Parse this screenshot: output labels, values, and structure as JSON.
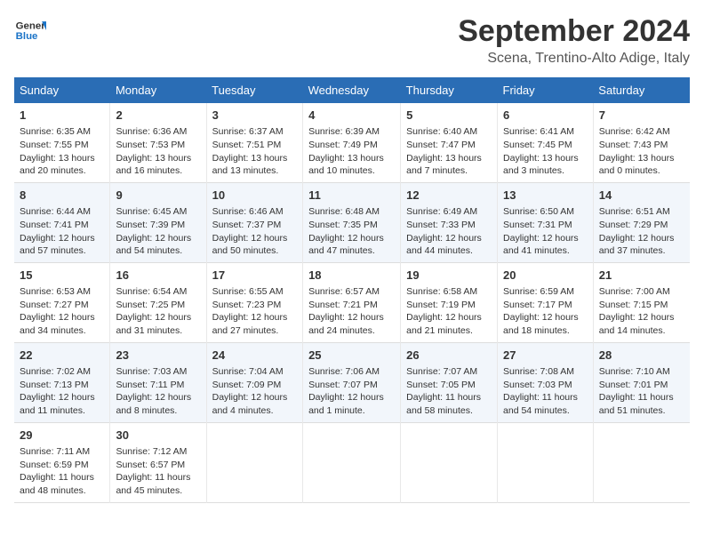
{
  "header": {
    "logo_general": "General",
    "logo_blue": "Blue",
    "month": "September 2024",
    "location": "Scena, Trentino-Alto Adige, Italy"
  },
  "days_of_week": [
    "Sunday",
    "Monday",
    "Tuesday",
    "Wednesday",
    "Thursday",
    "Friday",
    "Saturday"
  ],
  "weeks": [
    [
      {
        "day": "1",
        "lines": [
          "Sunrise: 6:35 AM",
          "Sunset: 7:55 PM",
          "Daylight: 13 hours",
          "and 20 minutes."
        ]
      },
      {
        "day": "2",
        "lines": [
          "Sunrise: 6:36 AM",
          "Sunset: 7:53 PM",
          "Daylight: 13 hours",
          "and 16 minutes."
        ]
      },
      {
        "day": "3",
        "lines": [
          "Sunrise: 6:37 AM",
          "Sunset: 7:51 PM",
          "Daylight: 13 hours",
          "and 13 minutes."
        ]
      },
      {
        "day": "4",
        "lines": [
          "Sunrise: 6:39 AM",
          "Sunset: 7:49 PM",
          "Daylight: 13 hours",
          "and 10 minutes."
        ]
      },
      {
        "day": "5",
        "lines": [
          "Sunrise: 6:40 AM",
          "Sunset: 7:47 PM",
          "Daylight: 13 hours",
          "and 7 minutes."
        ]
      },
      {
        "day": "6",
        "lines": [
          "Sunrise: 6:41 AM",
          "Sunset: 7:45 PM",
          "Daylight: 13 hours",
          "and 3 minutes."
        ]
      },
      {
        "day": "7",
        "lines": [
          "Sunrise: 6:42 AM",
          "Sunset: 7:43 PM",
          "Daylight: 13 hours",
          "and 0 minutes."
        ]
      }
    ],
    [
      {
        "day": "8",
        "lines": [
          "Sunrise: 6:44 AM",
          "Sunset: 7:41 PM",
          "Daylight: 12 hours",
          "and 57 minutes."
        ]
      },
      {
        "day": "9",
        "lines": [
          "Sunrise: 6:45 AM",
          "Sunset: 7:39 PM",
          "Daylight: 12 hours",
          "and 54 minutes."
        ]
      },
      {
        "day": "10",
        "lines": [
          "Sunrise: 6:46 AM",
          "Sunset: 7:37 PM",
          "Daylight: 12 hours",
          "and 50 minutes."
        ]
      },
      {
        "day": "11",
        "lines": [
          "Sunrise: 6:48 AM",
          "Sunset: 7:35 PM",
          "Daylight: 12 hours",
          "and 47 minutes."
        ]
      },
      {
        "day": "12",
        "lines": [
          "Sunrise: 6:49 AM",
          "Sunset: 7:33 PM",
          "Daylight: 12 hours",
          "and 44 minutes."
        ]
      },
      {
        "day": "13",
        "lines": [
          "Sunrise: 6:50 AM",
          "Sunset: 7:31 PM",
          "Daylight: 12 hours",
          "and 41 minutes."
        ]
      },
      {
        "day": "14",
        "lines": [
          "Sunrise: 6:51 AM",
          "Sunset: 7:29 PM",
          "Daylight: 12 hours",
          "and 37 minutes."
        ]
      }
    ],
    [
      {
        "day": "15",
        "lines": [
          "Sunrise: 6:53 AM",
          "Sunset: 7:27 PM",
          "Daylight: 12 hours",
          "and 34 minutes."
        ]
      },
      {
        "day": "16",
        "lines": [
          "Sunrise: 6:54 AM",
          "Sunset: 7:25 PM",
          "Daylight: 12 hours",
          "and 31 minutes."
        ]
      },
      {
        "day": "17",
        "lines": [
          "Sunrise: 6:55 AM",
          "Sunset: 7:23 PM",
          "Daylight: 12 hours",
          "and 27 minutes."
        ]
      },
      {
        "day": "18",
        "lines": [
          "Sunrise: 6:57 AM",
          "Sunset: 7:21 PM",
          "Daylight: 12 hours",
          "and 24 minutes."
        ]
      },
      {
        "day": "19",
        "lines": [
          "Sunrise: 6:58 AM",
          "Sunset: 7:19 PM",
          "Daylight: 12 hours",
          "and 21 minutes."
        ]
      },
      {
        "day": "20",
        "lines": [
          "Sunrise: 6:59 AM",
          "Sunset: 7:17 PM",
          "Daylight: 12 hours",
          "and 18 minutes."
        ]
      },
      {
        "day": "21",
        "lines": [
          "Sunrise: 7:00 AM",
          "Sunset: 7:15 PM",
          "Daylight: 12 hours",
          "and 14 minutes."
        ]
      }
    ],
    [
      {
        "day": "22",
        "lines": [
          "Sunrise: 7:02 AM",
          "Sunset: 7:13 PM",
          "Daylight: 12 hours",
          "and 11 minutes."
        ]
      },
      {
        "day": "23",
        "lines": [
          "Sunrise: 7:03 AM",
          "Sunset: 7:11 PM",
          "Daylight: 12 hours",
          "and 8 minutes."
        ]
      },
      {
        "day": "24",
        "lines": [
          "Sunrise: 7:04 AM",
          "Sunset: 7:09 PM",
          "Daylight: 12 hours",
          "and 4 minutes."
        ]
      },
      {
        "day": "25",
        "lines": [
          "Sunrise: 7:06 AM",
          "Sunset: 7:07 PM",
          "Daylight: 12 hours",
          "and 1 minute."
        ]
      },
      {
        "day": "26",
        "lines": [
          "Sunrise: 7:07 AM",
          "Sunset: 7:05 PM",
          "Daylight: 11 hours",
          "and 58 minutes."
        ]
      },
      {
        "day": "27",
        "lines": [
          "Sunrise: 7:08 AM",
          "Sunset: 7:03 PM",
          "Daylight: 11 hours",
          "and 54 minutes."
        ]
      },
      {
        "day": "28",
        "lines": [
          "Sunrise: 7:10 AM",
          "Sunset: 7:01 PM",
          "Daylight: 11 hours",
          "and 51 minutes."
        ]
      }
    ],
    [
      {
        "day": "29",
        "lines": [
          "Sunrise: 7:11 AM",
          "Sunset: 6:59 PM",
          "Daylight: 11 hours",
          "and 48 minutes."
        ]
      },
      {
        "day": "30",
        "lines": [
          "Sunrise: 7:12 AM",
          "Sunset: 6:57 PM",
          "Daylight: 11 hours",
          "and 45 minutes."
        ]
      },
      {
        "day": "",
        "lines": []
      },
      {
        "day": "",
        "lines": []
      },
      {
        "day": "",
        "lines": []
      },
      {
        "day": "",
        "lines": []
      },
      {
        "day": "",
        "lines": []
      }
    ]
  ]
}
